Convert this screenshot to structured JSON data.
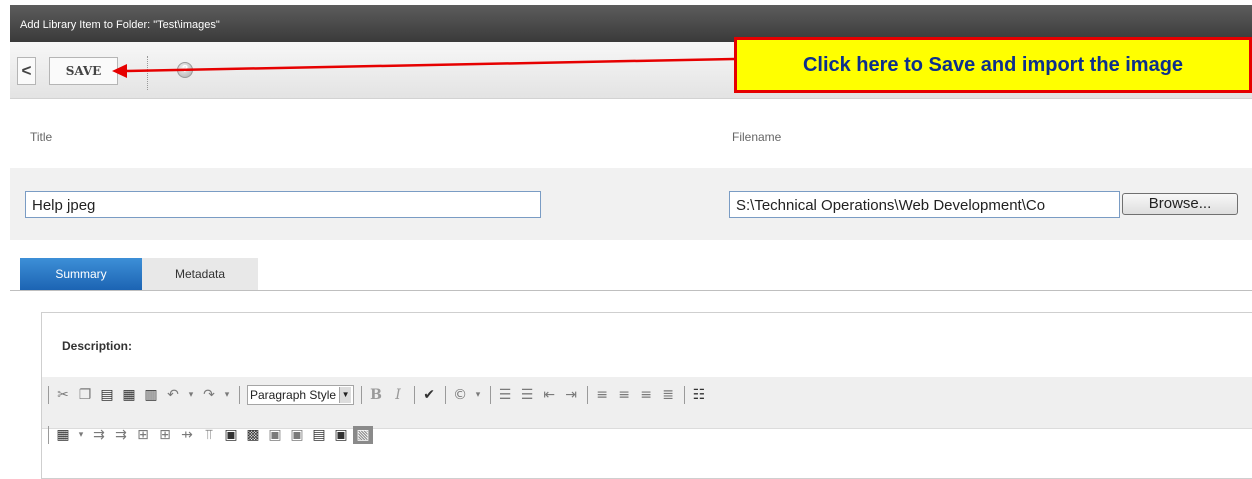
{
  "window": {
    "title": "Add Library Item to Folder: \"Test\\images\""
  },
  "toolbar": {
    "back_label": "<",
    "save_label": "SAVE",
    "help_label": "?"
  },
  "callout": {
    "text": "Click here to Save and import the image"
  },
  "form": {
    "title_label": "Title",
    "title_value": "Help jpeg",
    "filename_label": "Filename",
    "filename_value": "S:\\Technical Operations\\Web Development\\Co",
    "browse_label": "Browse..."
  },
  "tabs": [
    {
      "label": "Summary",
      "active": true
    },
    {
      "label": "Metadata",
      "active": false
    }
  ],
  "editor": {
    "description_label": "Description:",
    "paragraph_style": "Paragraph Style",
    "bold": "B",
    "italic": "I"
  },
  "colors": {
    "callout_bg": "#ffff00",
    "callout_border": "#e60000",
    "callout_text": "#0c2f8c",
    "active_tab": "#1c64b3"
  }
}
